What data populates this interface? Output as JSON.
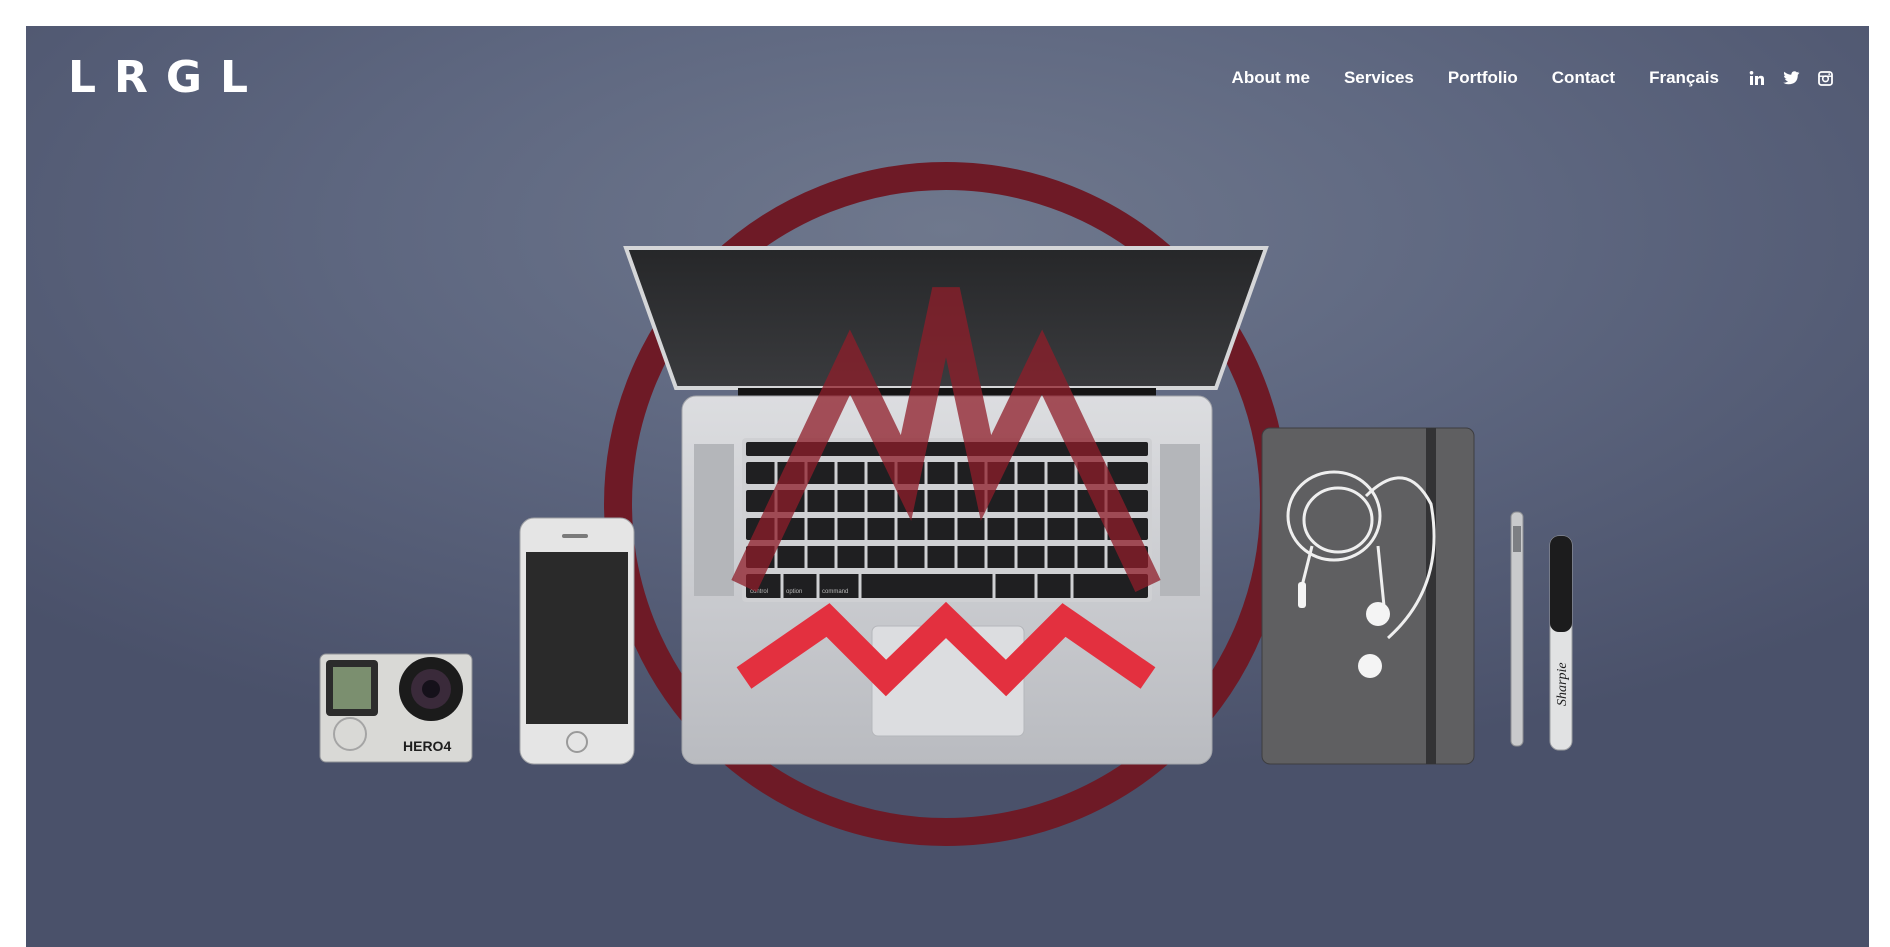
{
  "header": {
    "logo": "LRGL",
    "nav": [
      {
        "label": "About me"
      },
      {
        "label": "Services"
      },
      {
        "label": "Portfolio"
      },
      {
        "label": "Contact"
      },
      {
        "label": "Français"
      }
    ],
    "social": [
      "linkedin-icon",
      "twitter-icon",
      "instagram-icon"
    ]
  },
  "hero": {
    "camera_label": "HERO4",
    "pen_label": "Sharpie",
    "keyboard_labels": {
      "command": "command",
      "option": "option",
      "control": "control"
    }
  },
  "colors": {
    "background": "#5e6780",
    "accent": "#e3303f",
    "ring": "#6e1a26"
  }
}
